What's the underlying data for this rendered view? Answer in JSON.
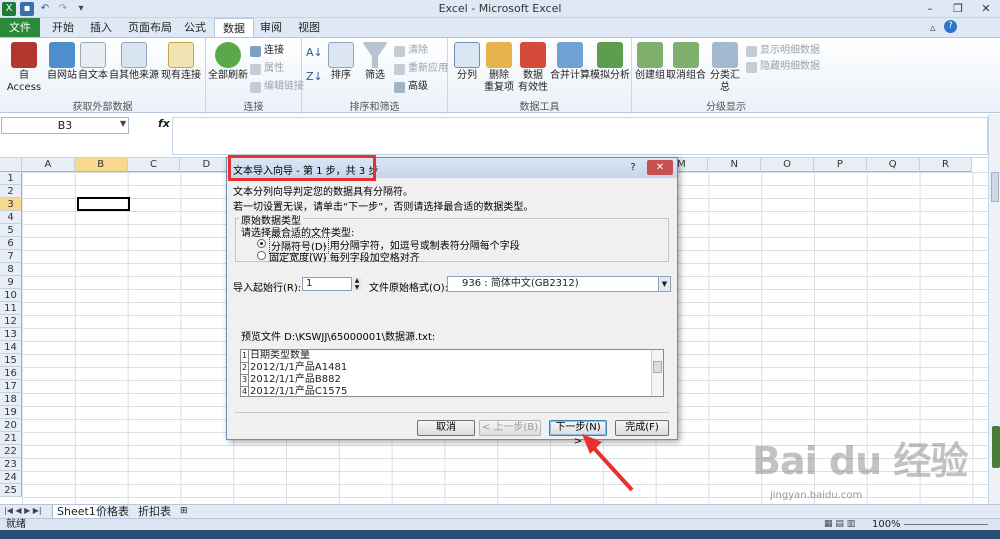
{
  "window": {
    "title": "Excel - Microsoft Excel"
  },
  "ribbon_tabs": [
    "文件",
    "开始",
    "插入",
    "页面布局",
    "公式",
    "数据",
    "审阅",
    "视图"
  ],
  "active_tab": "数据",
  "ribbon": {
    "external": {
      "label": "获取外部数据",
      "buttons": [
        "自 Access",
        "自网站",
        "自文本",
        "自其他来源",
        "现有连接"
      ]
    },
    "connections": {
      "label": "连接",
      "refresh": "全部刷新",
      "items": [
        "连接",
        "属性",
        "编辑链接"
      ]
    },
    "sort": {
      "label": "排序和筛选",
      "sort": "排序",
      "filter": "筛选",
      "items": [
        "清除",
        "重新应用",
        "高级"
      ]
    },
    "tools": {
      "label": "数据工具",
      "buttons": [
        "分列",
        "删除\n重复项",
        "数据\n有效性",
        "合并计算",
        "模拟分析"
      ]
    },
    "outline": {
      "label": "分级显示",
      "buttons": [
        "创建组",
        "取消组合",
        "分类汇总"
      ],
      "items": [
        "显示明细数据",
        "隐藏明细数据"
      ]
    }
  },
  "formula_bar": {
    "name_box": "B3",
    "fx": "fx",
    "value": ""
  },
  "grid": {
    "columns": [
      "A",
      "B",
      "C",
      "D",
      "E",
      "F",
      "G",
      "H",
      "I",
      "J",
      "K",
      "L",
      "M",
      "N",
      "O",
      "P",
      "Q",
      "R"
    ],
    "rows": [
      "1",
      "2",
      "3",
      "4",
      "5",
      "6",
      "7",
      "8",
      "9",
      "10",
      "11",
      "12",
      "13",
      "14",
      "15",
      "16",
      "17",
      "18",
      "19",
      "20",
      "21",
      "22",
      "23",
      "24",
      "25"
    ],
    "active_column": "B",
    "active_row": "3"
  },
  "sheets": [
    "Sheet1",
    "价格表",
    "折扣表"
  ],
  "active_sheet": "Sheet1",
  "status": {
    "text": "就绪",
    "zoom": "100%"
  },
  "dialog": {
    "title": "文本导入向导 - 第 1 步，共 3 步",
    "help": "?",
    "close": "✕",
    "line1": "文本分列向导判定您的数据具有分隔符。",
    "line2": "若一切设置无误，请单击“下一步”，否则请选择最合适的数据类型。",
    "group_label": "原始数据类型",
    "choose_label": "请选择最合适的文件类型:",
    "option_delimited": "分隔符号(D)",
    "option_delimited_desc": "- 用分隔字符，如逗号或制表符分隔每个字段",
    "option_fixed": "固定宽度(W)",
    "option_fixed_desc": "- 每列字段加空格对齐",
    "start_row_label": "导入起始行(R):",
    "start_row_value": "1",
    "origin_label": "文件原始格式(O):",
    "origin_value": "936 : 简体中文(GB2312)",
    "preview_label": "预览文件 D:\\KSWJJ\\65000001\\数据源.txt:",
    "preview_rows": [
      {
        "num": "1",
        "text": "日期类型数量"
      },
      {
        "num": "2",
        "text": "2012/1/1产品A1481"
      },
      {
        "num": "3",
        "text": "2012/1/1产品B882"
      },
      {
        "num": "4",
        "text": "2012/1/1产品C1575"
      }
    ],
    "buttons": {
      "cancel": "取消",
      "back": "< 上一步(B)",
      "next": "下一步(N) >",
      "finish": "完成(F)"
    }
  },
  "watermark": {
    "logo": "Bai du 经验",
    "url": "jingyan.baidu.com"
  },
  "colors": {
    "file_tab": "#2a8a3a",
    "highlight": "#e8312f",
    "active_header": "#f9d98f"
  }
}
